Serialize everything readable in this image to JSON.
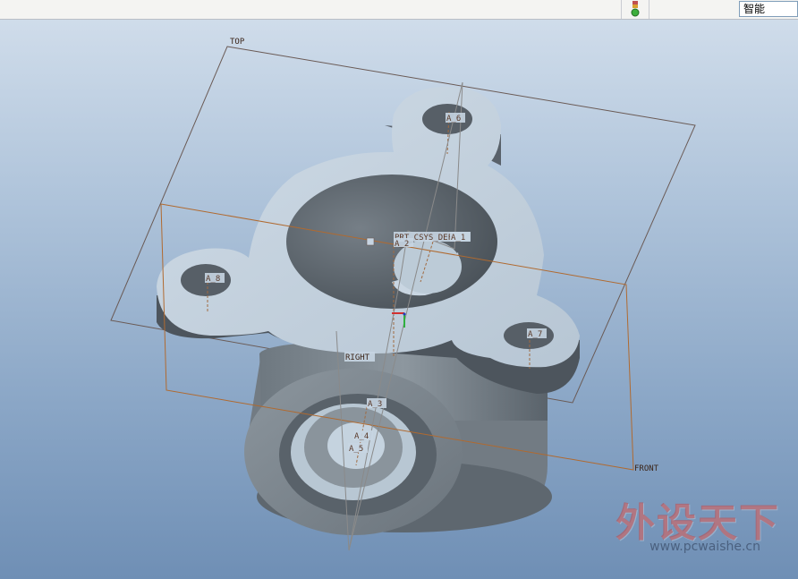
{
  "toolbar": {
    "filter_value": "智能"
  },
  "datum_planes": {
    "top": "TOP",
    "front": "FRONT",
    "right": "RIGHT"
  },
  "coordinate_system": "PRT_CSYS_DEF",
  "axes": {
    "a6": "A_6",
    "a8": "A_8",
    "a7": "A_7",
    "a2": "A_2",
    "a1": "A_1",
    "a3": "A_3",
    "a4": "A_4",
    "a5": "A_5"
  },
  "watermark": {
    "brand": "外设天下",
    "url": "www.pcwaishe.cn"
  },
  "colors": {
    "part_light": "#c3d2df",
    "part_mid": "#a3b2c0",
    "part_dark": "#4c545c",
    "datum": "#a07050"
  }
}
